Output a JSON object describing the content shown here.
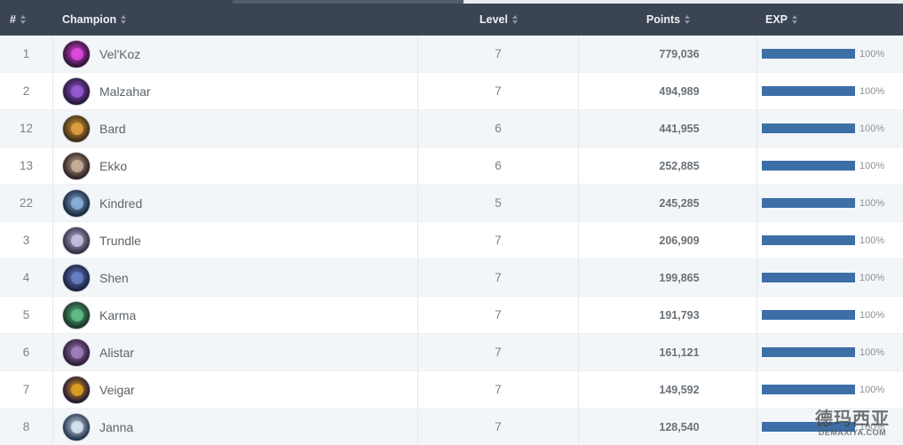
{
  "table": {
    "columns": {
      "rank": "#",
      "champion": "Champion",
      "level": "Level",
      "points": "Points",
      "exp": "EXP"
    },
    "rows": [
      {
        "rank": "1",
        "name": "Vel'Koz",
        "level": "7",
        "points": "779,036",
        "exp_label": "100%",
        "exp_fraction": 1.0,
        "avatar_bg": "#2a1030",
        "avatar_glow": "#e04ae0"
      },
      {
        "rank": "2",
        "name": "Malzahar",
        "level": "7",
        "points": "494,989",
        "exp_label": "100%",
        "exp_fraction": 1.0,
        "avatar_bg": "#241436",
        "avatar_glow": "#9a5ad8"
      },
      {
        "rank": "12",
        "name": "Bard",
        "level": "6",
        "points": "441,955",
        "exp_label": "100%",
        "exp_fraction": 1.0,
        "avatar_bg": "#3a2a14",
        "avatar_glow": "#e0a040"
      },
      {
        "rank": "13",
        "name": "Ekko",
        "level": "6",
        "points": "252,885",
        "exp_label": "100%",
        "exp_fraction": 1.0,
        "avatar_bg": "#2a1c1c",
        "avatar_glow": "#c8b098"
      },
      {
        "rank": "22",
        "name": "Kindred",
        "level": "5",
        "points": "245,285",
        "exp_label": "100%",
        "exp_fraction": 1.0,
        "avatar_bg": "#14243a",
        "avatar_glow": "#8ab0d8"
      },
      {
        "rank": "3",
        "name": "Trundle",
        "level": "7",
        "points": "206,909",
        "exp_label": "100%",
        "exp_fraction": 1.0,
        "avatar_bg": "#2c2a40",
        "avatar_glow": "#c8c0e0"
      },
      {
        "rank": "4",
        "name": "Shen",
        "level": "7",
        "points": "199,865",
        "exp_label": "100%",
        "exp_fraction": 1.0,
        "avatar_bg": "#18203a",
        "avatar_glow": "#6a80c8"
      },
      {
        "rank": "5",
        "name": "Karma",
        "level": "7",
        "points": "191,793",
        "exp_label": "100%",
        "exp_fraction": 1.0,
        "avatar_bg": "#183024",
        "avatar_glow": "#60c088"
      },
      {
        "rank": "6",
        "name": "Alistar",
        "level": "7",
        "points": "161,121",
        "exp_label": "100%",
        "exp_fraction": 1.0,
        "avatar_bg": "#2a1a34",
        "avatar_glow": "#a080c0"
      },
      {
        "rank": "7",
        "name": "Veigar",
        "level": "7",
        "points": "149,592",
        "exp_label": "100%",
        "exp_fraction": 1.0,
        "avatar_bg": "#1e1430",
        "avatar_glow": "#e0a020"
      },
      {
        "rank": "8",
        "name": "Janna",
        "level": "7",
        "points": "128,540",
        "exp_label": "100%",
        "exp_fraction": 1.0,
        "avatar_bg": "#20304a",
        "avatar_glow": "#d8e4f4"
      }
    ]
  },
  "colors": {
    "header_bg": "#3b4453",
    "exp_bar": "#3d6fa6",
    "row_alt": "#f3f6f9"
  },
  "watermark": {
    "title": "德玛西亚",
    "url": "DEMAXIYA.COM"
  }
}
